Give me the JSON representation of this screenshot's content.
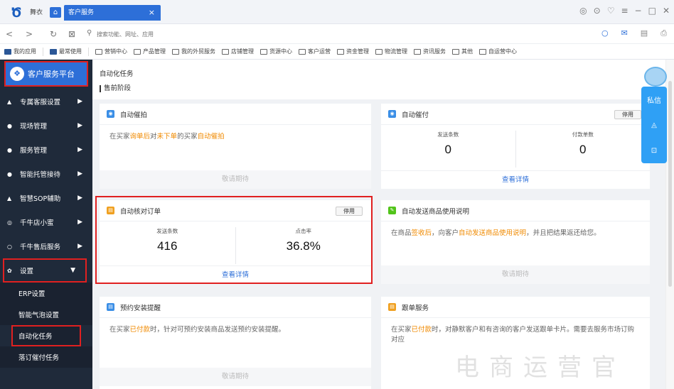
{
  "titlebar": {
    "tab_plain": "舞衣",
    "tab_active": "客户服务",
    "close_glyph": "×",
    "controls": [
      "◎",
      "⊙",
      "♡",
      "≡",
      "−",
      "□",
      "✕"
    ]
  },
  "addressbar": {
    "placeholder": "搜索功能、网址、应用"
  },
  "bookmarks": [
    "我的应用",
    "最常使用",
    "营销中心",
    "产品管理",
    "我的外贸服务",
    "店铺管理",
    "货源中心",
    "客户运营",
    "资金管理",
    "物流管理",
    "资讯服务",
    "其他",
    "自运营中心"
  ],
  "sidebar": {
    "platform": "客户服务平台",
    "items": [
      {
        "icon": "▲",
        "label": "专属客服设置"
      },
      {
        "icon": "●",
        "label": "现场管理"
      },
      {
        "icon": "●",
        "label": "服务管理"
      },
      {
        "icon": "●",
        "label": "智能托管接待"
      },
      {
        "icon": "▲",
        "label": "智慧SOP辅助"
      },
      {
        "icon": "◎",
        "label": "千牛店小蜜"
      },
      {
        "icon": "○",
        "label": "千牛售后服务"
      }
    ],
    "settings": {
      "icon": "✿",
      "label": "设置"
    },
    "sub_items": [
      "ERP设置",
      "智能气泡设置",
      "自动化任务",
      "落订催付任务"
    ]
  },
  "main": {
    "title": "自动化任务",
    "subtitle": "售前阶段",
    "cards": {
      "auto_pai": {
        "title": "自动催拍",
        "body_parts": [
          "在买家",
          "询单后",
          "对",
          "未下单",
          "的买家",
          "自动催拍"
        ],
        "footer": "敬请期待"
      },
      "auto_fu": {
        "title": "自动催付",
        "stop": "停用",
        "stat1_label": "发送条数",
        "stat1_value": "0",
        "stat2_label": "付款单数",
        "stat2_value": "0",
        "footer": "查看详情"
      },
      "verify": {
        "title": "自动核对订单",
        "stop": "停用",
        "stat1_label": "发送条数",
        "stat1_value": "416",
        "stat2_label": "点击率",
        "stat2_value": "36.8%",
        "footer": "查看详情"
      },
      "instructions": {
        "title": "自动发送商品使用说明",
        "body_parts": [
          "在商品",
          "签收后",
          "，向客户",
          "自动发送商品使用说明",
          "，并且把结果返还给您。"
        ],
        "footer": "敬请期待"
      },
      "install": {
        "title": "预约安装提醒",
        "body_parts": [
          "在买家",
          "已付款",
          "时，针对可预约安装商品发送预约安装提醒。"
        ],
        "footer": "敬请期待"
      },
      "follow": {
        "title": "跟单服务",
        "body_parts": [
          "在买家",
          "已付款",
          "时，对静默客户和有咨询的客户发送跟单卡片。需要去服务市场订购对应"
        ]
      }
    }
  },
  "float_panel": [
    "私信",
    "◬",
    "⊡"
  ],
  "watermark": "电商运营官"
}
